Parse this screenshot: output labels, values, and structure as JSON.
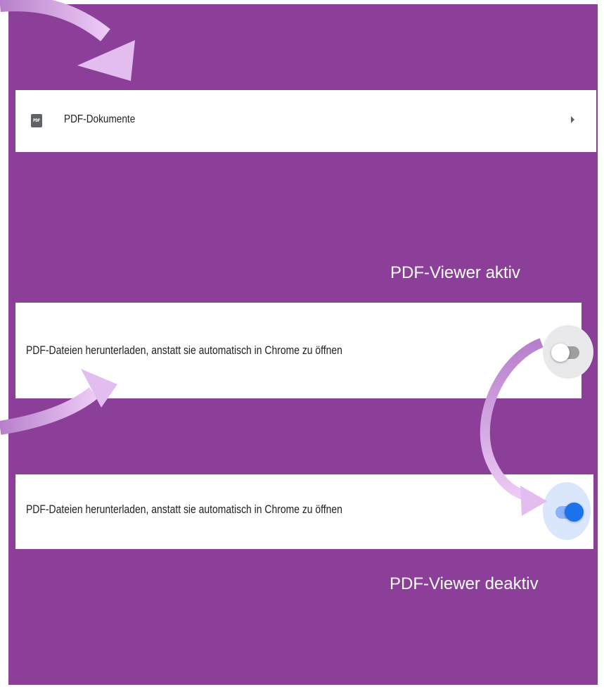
{
  "pdf_documents": {
    "icon": "pdf-document-icon",
    "icon_text": "PDF",
    "label": "PDF-Dokumente",
    "chevron": "chevron-right-icon"
  },
  "captions": {
    "aktiv": "PDF-Viewer aktiv",
    "deaktiv": "PDF-Viewer deaktiv"
  },
  "setting_off": {
    "text": "PDF-Dateien herunterladen, anstatt sie automatisch in Chrome zu öffnen",
    "toggle_state": "off"
  },
  "setting_on": {
    "text": "PDF-Dateien herunterladen, anstatt sie automatisch in Chrome zu öffnen",
    "toggle_state": "on"
  },
  "colors": {
    "background": "#8c3f98",
    "arrow": "#e1b8ee",
    "toggle_on": "#1a73e8"
  }
}
